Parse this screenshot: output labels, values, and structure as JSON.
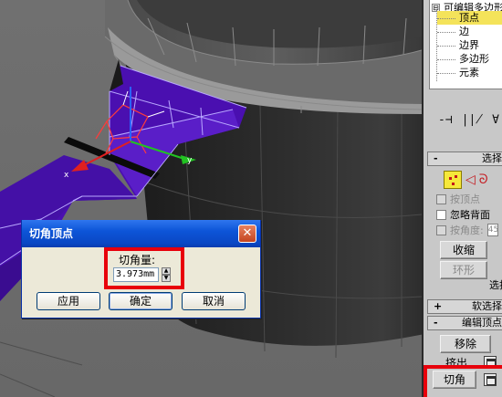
{
  "panel": {
    "tree": {
      "root_label": "可编辑多边形",
      "root_toggle": "⊟",
      "items": [
        {
          "label": "顶点",
          "selected": true
        },
        {
          "label": "边",
          "selected": false
        },
        {
          "label": "边界",
          "selected": false
        },
        {
          "label": "多边形",
          "selected": false
        },
        {
          "label": "元素",
          "selected": false
        }
      ]
    },
    "toolbar_glyphs": [
      "-⊣",
      "|∤",
      "∀"
    ],
    "selection_rollout": {
      "toggle": "-",
      "title": "选择"
    },
    "by_vertex_label": "按顶点",
    "ignore_backfacing_label": "忽略背面",
    "by_angle_label": "按角度:",
    "by_angle_value": "45",
    "shrink_label": "收缩",
    "ring_label": "环形",
    "select_suffix": "选择",
    "soft_selection_rollout": {
      "toggle": "+",
      "title": "软选择"
    },
    "edit_vertices_rollout": {
      "toggle": "-",
      "title": "编辑顶点"
    },
    "remove_label": "移除",
    "extrude_label": "挤出",
    "chamfer_label": "切角"
  },
  "dialog": {
    "title": "切角顶点",
    "close_glyph": "✕",
    "amount_label": "切角量:",
    "amount_value": "3.973mm",
    "spinner_up": "▲",
    "spinner_down": "▼",
    "apply_label": "应用",
    "ok_label": "确定",
    "cancel_label": "取消"
  },
  "colors": {
    "viewport_bg": "#6b6b6b",
    "pot_body": "#2a2a2a",
    "handle_purple": "#4a0fb0",
    "selection_yellow": "#f4e35a",
    "highlight_red": "#e8000b",
    "xp_title_blue": "#0a47c4"
  }
}
